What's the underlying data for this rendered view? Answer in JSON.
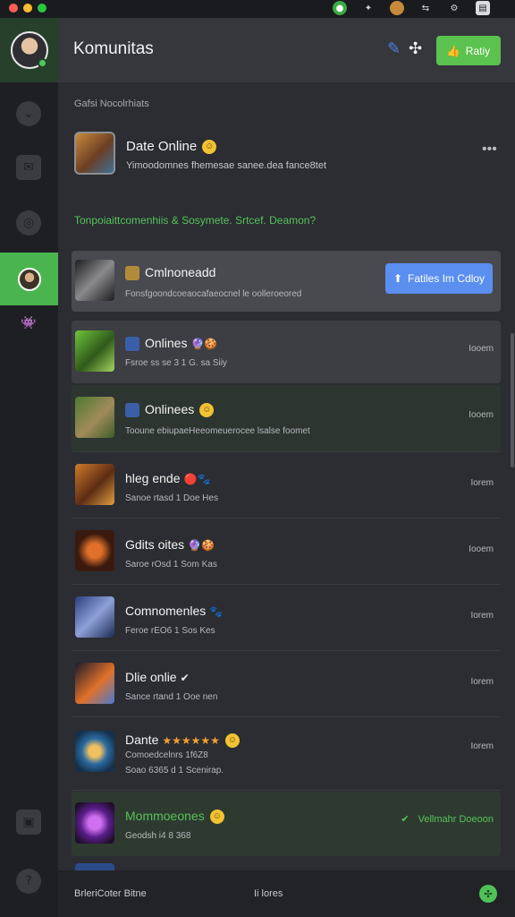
{
  "window": {
    "colors": {
      "accent_green": "#5bc24f",
      "accent_blue": "#5a8ff0",
      "traffic_red": "#ff5f57",
      "traffic_yellow": "#febc2e",
      "traffic_green": "#28c840"
    }
  },
  "header": {
    "title": "Komunitas",
    "action_button_label": "Ratiy",
    "icons": [
      "compose-icon",
      "expand-icon"
    ]
  },
  "sidebar": {
    "items": [
      "chevron-down-icon",
      "inbox-icon",
      "pin-icon",
      "community-thumb",
      "game-icon"
    ],
    "bottom_items": [
      "briefcase-icon",
      "help-icon"
    ]
  },
  "content": {
    "section_label": "Gafsi Nocolrhiats",
    "featured": {
      "title": "Date Online",
      "subtitle": "Yimoodomnes fhemesae sanee.dea fance8tet"
    },
    "green_note": "Tonpoiaittcomenhiis & Sosymete. Srtcef. Deamon?",
    "rows": [
      {
        "title": "Cmlnoneadd",
        "subtitle": "Fonsfgoondcoeaocafaeocnel le oolleroeored",
        "time": "",
        "button": "Fatiles Im Cdloy",
        "highlight": "selected"
      },
      {
        "title": "Onlines",
        "subtitle": "Fsroe ss se 3 1 G. sa Siiy",
        "time": "Iooem",
        "highlight": "hover"
      },
      {
        "title": "Onlinees",
        "subtitle": "Tooune ebiupaeHeeomeuerocee lsalse foomet",
        "time": "Iooem",
        "highlight": "none"
      },
      {
        "title": "hleg ende",
        "subtitle": "Sanoe rtasd 1 Doe Hes",
        "time": "Iorem",
        "highlight": "none"
      },
      {
        "title": "Gdits oites",
        "subtitle": "Saroe rOsd 1 Som Kas",
        "time": "Iooem",
        "highlight": "none"
      },
      {
        "title": "Comnomenles",
        "subtitle": "Feroe rEO6 1 Sos Kes",
        "time": "Iorem",
        "highlight": "none"
      },
      {
        "title": "Dlie onlie",
        "subtitle": "Sance rtand 1 Ooe nen",
        "time": "Iorem",
        "highlight": "none"
      },
      {
        "title": "Dante",
        "subtitle_line1": "Comoedcelnrs 1f6Z8",
        "subtitle": "Soao 6365 d 1 Scenirap.",
        "time": "Iorem",
        "highlight": "none"
      },
      {
        "title": "Mommoeones",
        "subtitle": "Geodsh i4 8 368",
        "time": "Vellmahr Doeoon",
        "highlight": "green"
      }
    ]
  },
  "footer": {
    "left": "BrleriCoter Bitne",
    "middle": "Ii lores"
  }
}
